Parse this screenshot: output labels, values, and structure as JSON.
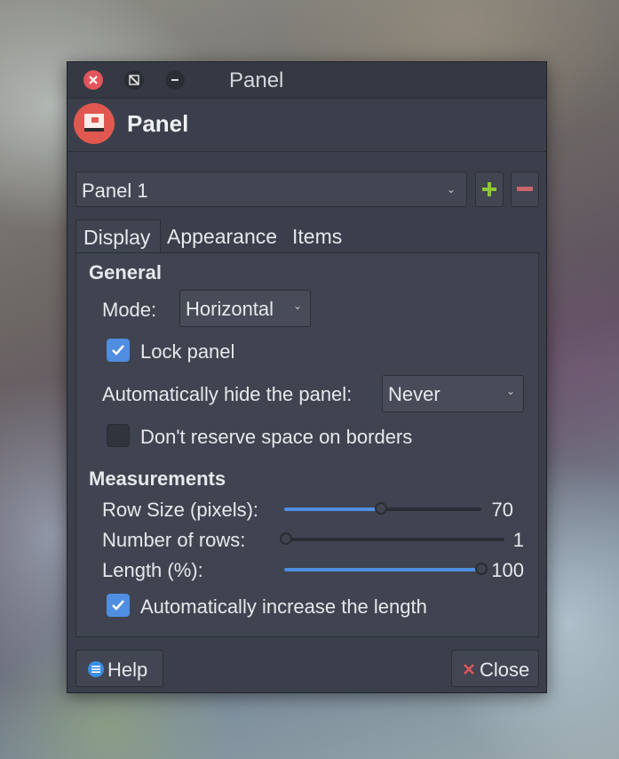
{
  "window": {
    "title": "Panel"
  },
  "header": {
    "title": "Panel",
    "icon": "panel-preferences-icon"
  },
  "panel_selector": {
    "selected": "Panel 1",
    "add_icon": "plus-icon",
    "remove_icon": "minus-icon"
  },
  "tabs": [
    {
      "label": "Display",
      "active": true
    },
    {
      "label": "Appearance",
      "active": false
    },
    {
      "label": "Items",
      "active": false
    }
  ],
  "general": {
    "heading": "General",
    "mode_label": "Mode:",
    "mode_value": "Horizontal",
    "lock_label": "Lock panel",
    "lock_checked": true,
    "autohide_label": "Automatically hide the panel:",
    "autohide_value": "Never",
    "reserve_label": "Don't reserve space on borders",
    "reserve_checked": false
  },
  "measurements": {
    "heading": "Measurements",
    "row_size_label": "Row Size (pixels):",
    "row_size_value": "70",
    "row_size_fraction": 0.49,
    "rows_label": "Number of rows:",
    "rows_value": "1",
    "rows_fraction": 0.0,
    "length_label": "Length (%):",
    "length_value": "100",
    "length_fraction": 1.0,
    "auto_increase_label": "Automatically increase the length",
    "auto_increase_checked": true
  },
  "buttons": {
    "help": "Help",
    "close": "Close"
  },
  "colors": {
    "accent": "#4f8ee0",
    "close_red": "#e2555b",
    "add_green": "#8ec72f"
  }
}
